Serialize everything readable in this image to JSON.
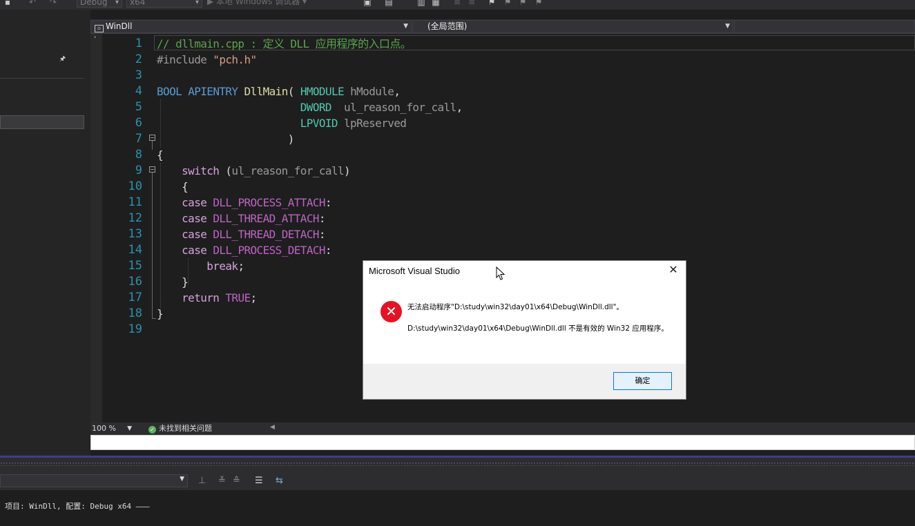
{
  "toolbar": {
    "config_select": "Debug",
    "platform_select": "x64",
    "run_label": "▶ 本地 Windows 调试器 ▾"
  },
  "navbar": {
    "file_label": "WinDll",
    "scope_label": "(全局范围)"
  },
  "editor": {
    "line_numbers": [
      "1",
      "2",
      "3",
      "4",
      "5",
      "6",
      "7",
      "8",
      "9",
      "10",
      "11",
      "12",
      "13",
      "14",
      "15",
      "16",
      "17",
      "18",
      "19"
    ],
    "code_lines": [
      "// dllmain.cpp : 定义 DLL 应用程序的入口点。",
      "#include \"pch.h\"",
      "",
      "BOOL APIENTRY DllMain( HMODULE hModule,",
      "                       DWORD  ul_reason_for_call,",
      "                       LPVOID lpReserved",
      "                     )",
      "{",
      "    switch (ul_reason_for_call)",
      "    {",
      "    case DLL_PROCESS_ATTACH:",
      "    case DLL_THREAD_ATTACH:",
      "    case DLL_THREAD_DETACH:",
      "    case DLL_PROCESS_DETACH:",
      "        break;",
      "    }",
      "    return TRUE;",
      "}",
      ""
    ]
  },
  "status": {
    "zoom": "100 %",
    "issues": "未找到相关问题"
  },
  "output": {
    "text": "项目: WinDll, 配置: Debug x64 ———"
  },
  "dialog": {
    "title": "Microsoft Visual Studio",
    "message1": "无法启动程序\"D:\\study\\win32\\day01\\x64\\Debug\\WinDll.dll\"。",
    "message2": "D:\\study\\win32\\day01\\x64\\Debug\\WinDll.dll 不是有效的 Win32 应用程序。",
    "ok_label": "确定"
  },
  "colors": {
    "error": "#e81123",
    "accent": "#0078d7",
    "keyword": "#569cd6",
    "type": "#4ec9b0",
    "comment": "#57a64a"
  }
}
